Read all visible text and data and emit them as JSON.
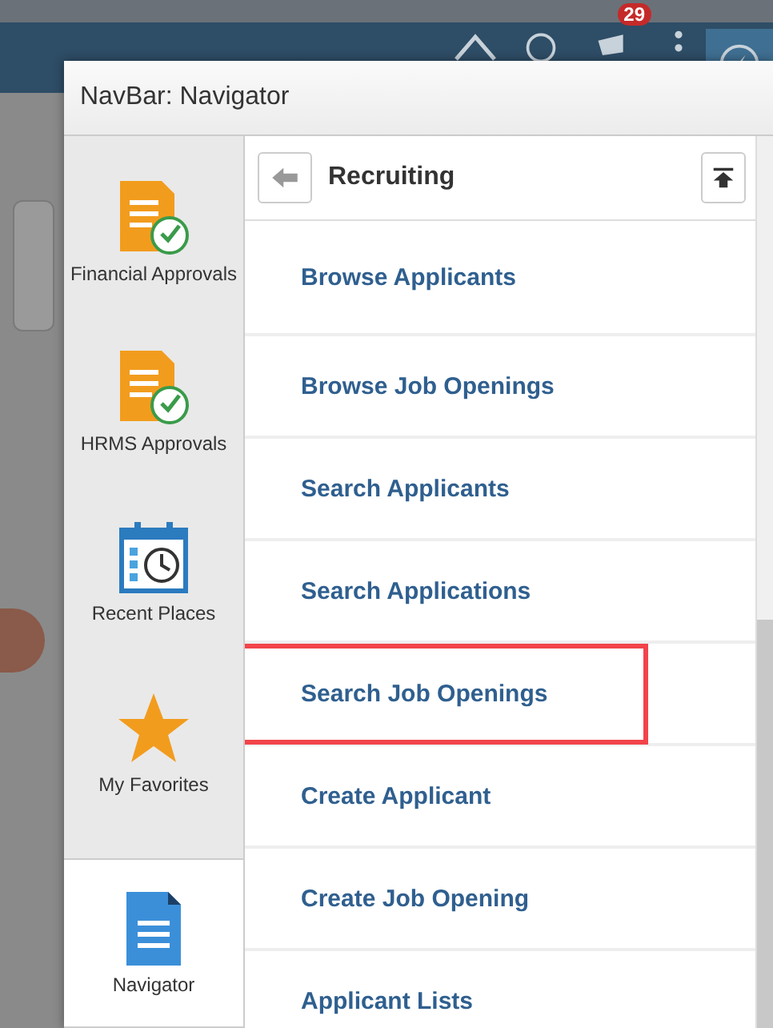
{
  "header": {
    "notification_count": "29"
  },
  "dialog": {
    "title": "NavBar: Navigator"
  },
  "sidebar": {
    "items": [
      {
        "label": "Financial Approvals",
        "kind": "approval",
        "selected": false
      },
      {
        "label": "HRMS Approvals",
        "kind": "approval",
        "selected": false
      },
      {
        "label": "Recent Places",
        "kind": "recent",
        "selected": false
      },
      {
        "label": "My Favorites",
        "kind": "favorites",
        "selected": false
      },
      {
        "label": "Navigator",
        "kind": "navigator",
        "selected": true
      }
    ]
  },
  "panel": {
    "title": "Recruiting",
    "items": [
      {
        "label": "Browse Applicants",
        "highlighted": false
      },
      {
        "label": "Browse Job Openings",
        "highlighted": false
      },
      {
        "label": "Search Applicants",
        "highlighted": false
      },
      {
        "label": "Search Applications",
        "highlighted": false
      },
      {
        "label": "Search Job Openings",
        "highlighted": true
      },
      {
        "label": "Create Applicant",
        "highlighted": false
      },
      {
        "label": "Create Job Opening",
        "highlighted": false
      },
      {
        "label": "Applicant Lists",
        "highlighted": false
      }
    ]
  }
}
